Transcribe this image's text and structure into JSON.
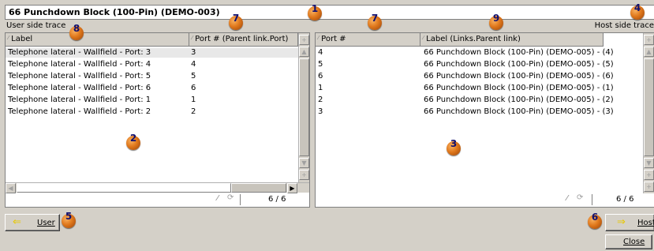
{
  "window": {
    "title": "66 Punchdown Block (100-Pin) (DEMO-003)"
  },
  "left": {
    "trace_label": "User side trace",
    "columns": [
      "Label",
      "Port # (Parent link.Port)"
    ],
    "rows": [
      [
        "Telephone lateral - Wallfield - Port: 3",
        "3"
      ],
      [
        "Telephone lateral - Wallfield - Port: 4",
        "4"
      ],
      [
        "Telephone lateral - Wallfield - Port: 5",
        "5"
      ],
      [
        "Telephone lateral - Wallfield - Port: 6",
        "6"
      ],
      [
        "Telephone lateral - Wallfield - Port: 1",
        "1"
      ],
      [
        "Telephone lateral - Wallfield - Port: 2",
        "2"
      ]
    ],
    "count": "6 / 6"
  },
  "right": {
    "trace_label": "Host side trace",
    "columns": [
      "Port #",
      "Label (Links.Parent link)"
    ],
    "rows": [
      [
        "4",
        "66 Punchdown Block (100-Pin) (DEMO-005) - (4)"
      ],
      [
        "5",
        "66 Punchdown Block (100-Pin) (DEMO-005) - (5)"
      ],
      [
        "6",
        "66 Punchdown Block (100-Pin) (DEMO-005) - (6)"
      ],
      [
        "1",
        "66 Punchdown Block (100-Pin) (DEMO-005) - (1)"
      ],
      [
        "2",
        "66 Punchdown Block (100-Pin) (DEMO-005) - (2)"
      ],
      [
        "3",
        "66 Punchdown Block (100-Pin) (DEMO-005) - (3)"
      ]
    ],
    "count": "6 / 6"
  },
  "buttons": {
    "user": "User",
    "host": "Host",
    "close": "Close"
  },
  "callouts": [
    "1",
    "2",
    "3",
    "4",
    "5",
    "6",
    "7",
    "7",
    "8",
    "9"
  ],
  "colors": {
    "panel_bg": "#d4d0c8",
    "badge": "#e0781c",
    "badge_text": "#101070",
    "arrow": "#e8c800"
  }
}
